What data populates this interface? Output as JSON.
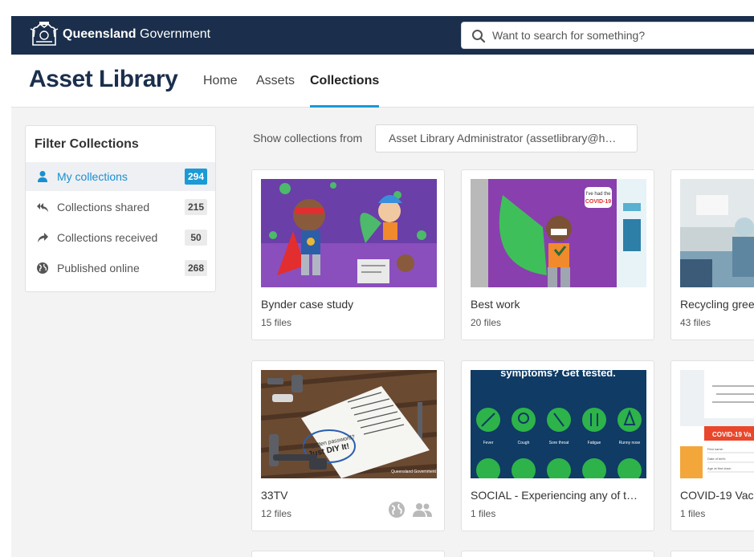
{
  "gov_header": {
    "name_bold": "Queensland",
    "name_rest": " Government",
    "search_placeholder": "Want to search for something?"
  },
  "app": {
    "title": "Asset Library",
    "nav": [
      {
        "label": "Home",
        "active": false
      },
      {
        "label": "Assets",
        "active": false
      },
      {
        "label": "Collections",
        "active": true
      }
    ]
  },
  "filter": {
    "heading": "Filter Collections",
    "items": [
      {
        "label": "My collections",
        "count": "294",
        "icon": "user-icon",
        "active": true
      },
      {
        "label": "Collections shared",
        "count": "215",
        "icon": "reply-all-icon",
        "active": false
      },
      {
        "label": "Collections received",
        "count": "50",
        "icon": "share-icon",
        "active": false
      },
      {
        "label": "Published online",
        "count": "268",
        "icon": "globe-icon",
        "active": false
      }
    ]
  },
  "show_from": {
    "label": "Show collections from",
    "value": "Asset Library Administrator (assetlibrary@h…"
  },
  "collections": [
    {
      "title": "Bynder case study",
      "files": "15 files"
    },
    {
      "title": "Best work",
      "files": "20 files"
    },
    {
      "title": "Recycling gree",
      "files": "43 files"
    },
    {
      "title": "33TV",
      "files": "12 files",
      "icons": [
        "globe-icon",
        "people-icon"
      ]
    },
    {
      "title": "SOCIAL - Experiencing any of t…",
      "files": "1 files"
    },
    {
      "title": "COVID-19 Vacc",
      "files": "1 files"
    }
  ],
  "thumb_text": {
    "covid_badge_top": "I've had the",
    "covid_badge_main": "COVID-19",
    "social_header": "symptoms? Get tested.",
    "social_labels": [
      "Fever",
      "Cough",
      "Sore throat",
      "Fatigue",
      "Runny nose"
    ],
    "vacc_banner": "COVID-19 Va",
    "vacc_fields": [
      "First name:",
      "Date of birth:",
      "Age at first dose:"
    ],
    "note_lines": [
      "Forgotten password?",
      "Just DIY It!"
    ],
    "qld_watermark": "Queensland Government"
  },
  "colors": {
    "gov_navy": "#1b2f4c",
    "accent_blue": "#1a9ad6",
    "social_bg": "#0f3b64",
    "social_green": "#2db34a"
  }
}
